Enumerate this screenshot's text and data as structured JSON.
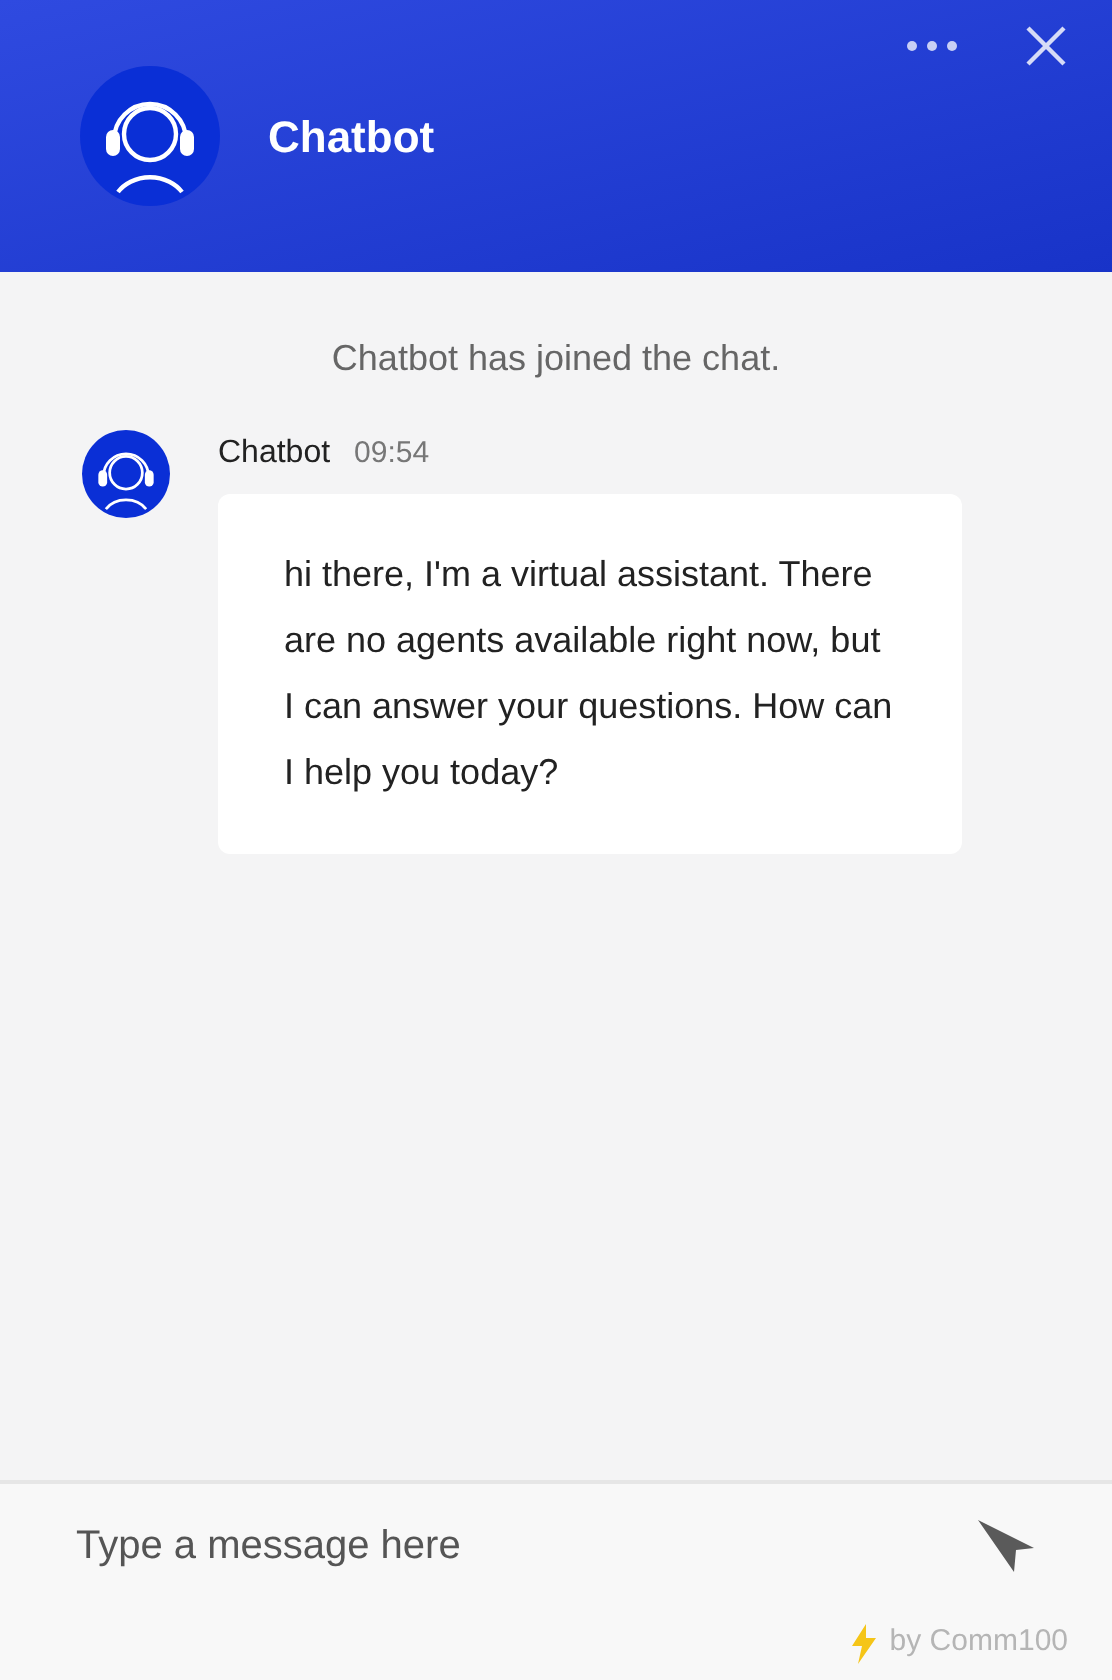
{
  "header": {
    "title": "Chatbot"
  },
  "system_message": "Chatbot has joined the chat.",
  "messages": [
    {
      "sender": "Chatbot",
      "time": "09:54",
      "text": "hi there, I'm a virtual assistant. There are no agents available right now, but I can answer your questions. How can I help you today?"
    }
  ],
  "composer": {
    "placeholder": "Type a message here"
  },
  "footer": {
    "credit": "by Comm100"
  }
}
